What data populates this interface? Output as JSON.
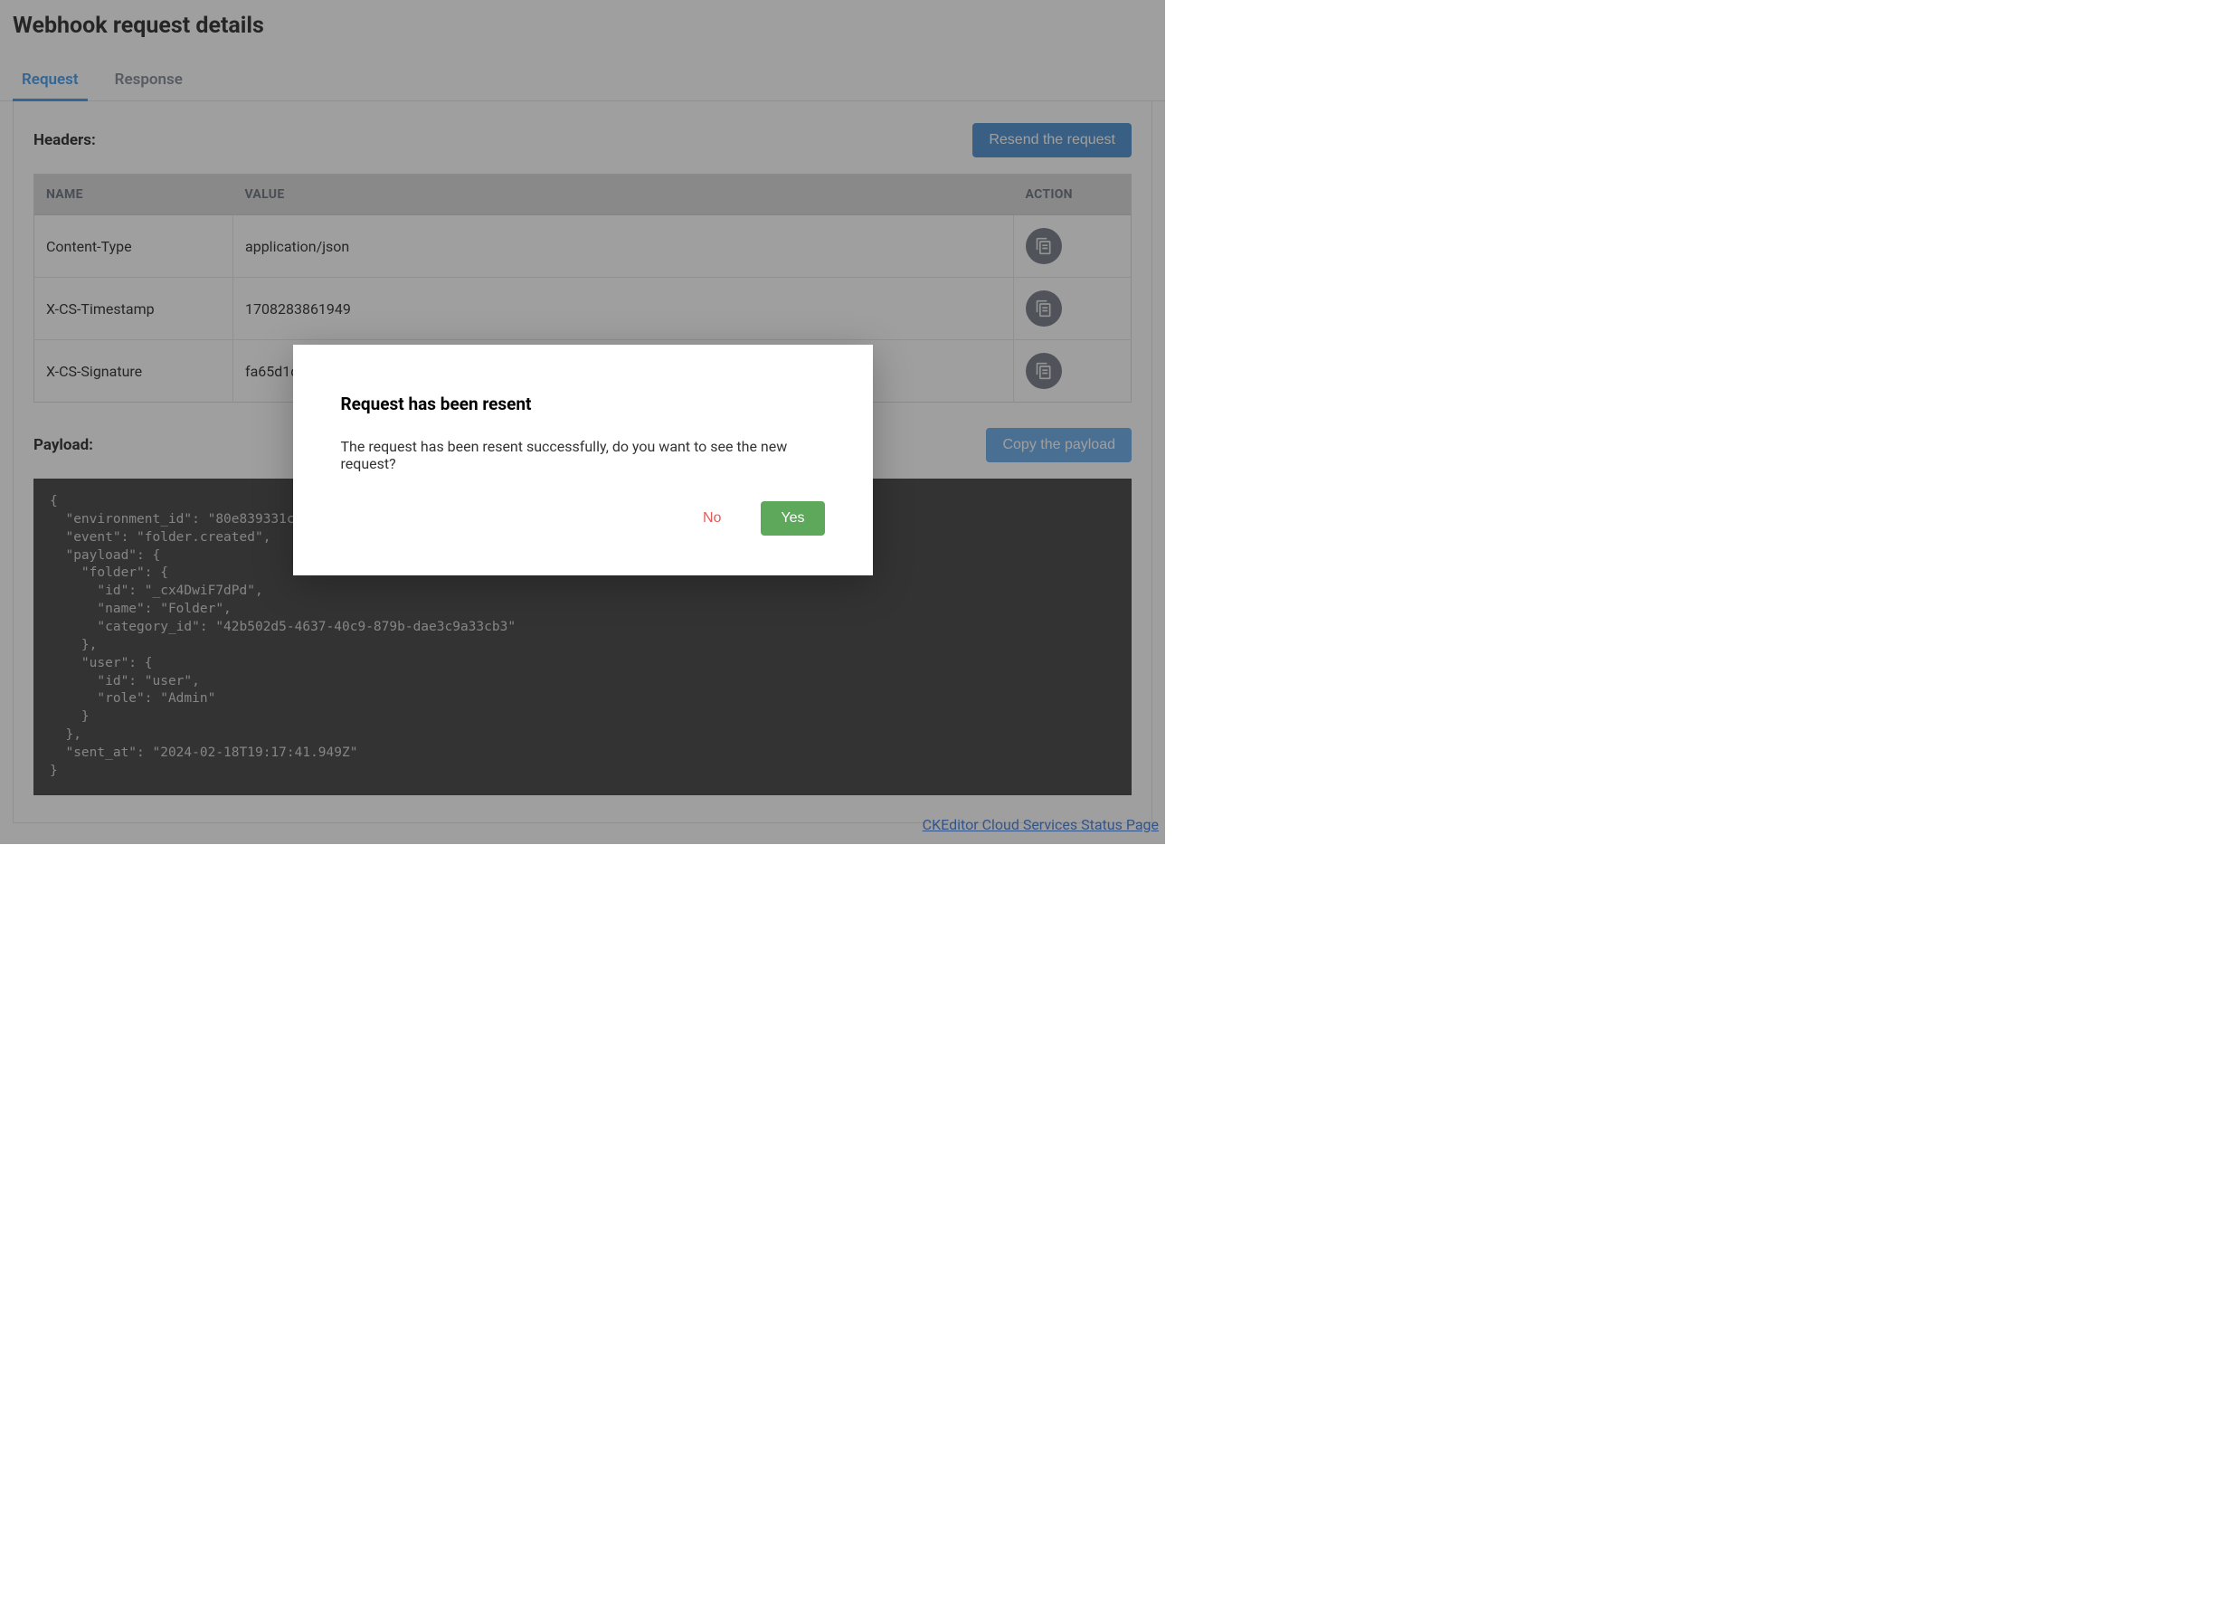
{
  "page_title": "Webhook request details",
  "tabs": {
    "request": "Request",
    "response": "Response"
  },
  "headers_section": {
    "label": "Headers:",
    "resend_button": "Resend the request",
    "columns": {
      "name": "NAME",
      "value": "VALUE",
      "action": "ACTION"
    },
    "rows": [
      {
        "name": "Content-Type",
        "value": "application/json"
      },
      {
        "name": "X-CS-Timestamp",
        "value": "1708283861949"
      },
      {
        "name": "X-CS-Signature",
        "value": "fa65d1d"
      }
    ]
  },
  "payload_section": {
    "label": "Payload:",
    "copy_button": "Copy the payload",
    "payload_text": "{\n  \"environment_id\": \"80e839331c4d88\n  \"event\": \"folder.created\",\n  \"payload\": {\n    \"folder\": {\n      \"id\": \"_cx4DwiF7dPd\",\n      \"name\": \"Folder\",\n      \"category_id\": \"42b502d5-4637-40c9-879b-dae3c9a33cb3\"\n    },\n    \"user\": {\n      \"id\": \"user\",\n      \"role\": \"Admin\"\n    }\n  },\n  \"sent_at\": \"2024-02-18T19:17:41.949Z\"\n}"
  },
  "footer_link": "CKEditor Cloud Services Status Page",
  "modal": {
    "title": "Request has been resent",
    "body": "The request has been resent successfully, do you want to see the new request?",
    "no": "No",
    "yes": "Yes"
  },
  "icons": {
    "copy": "copy-icon"
  }
}
